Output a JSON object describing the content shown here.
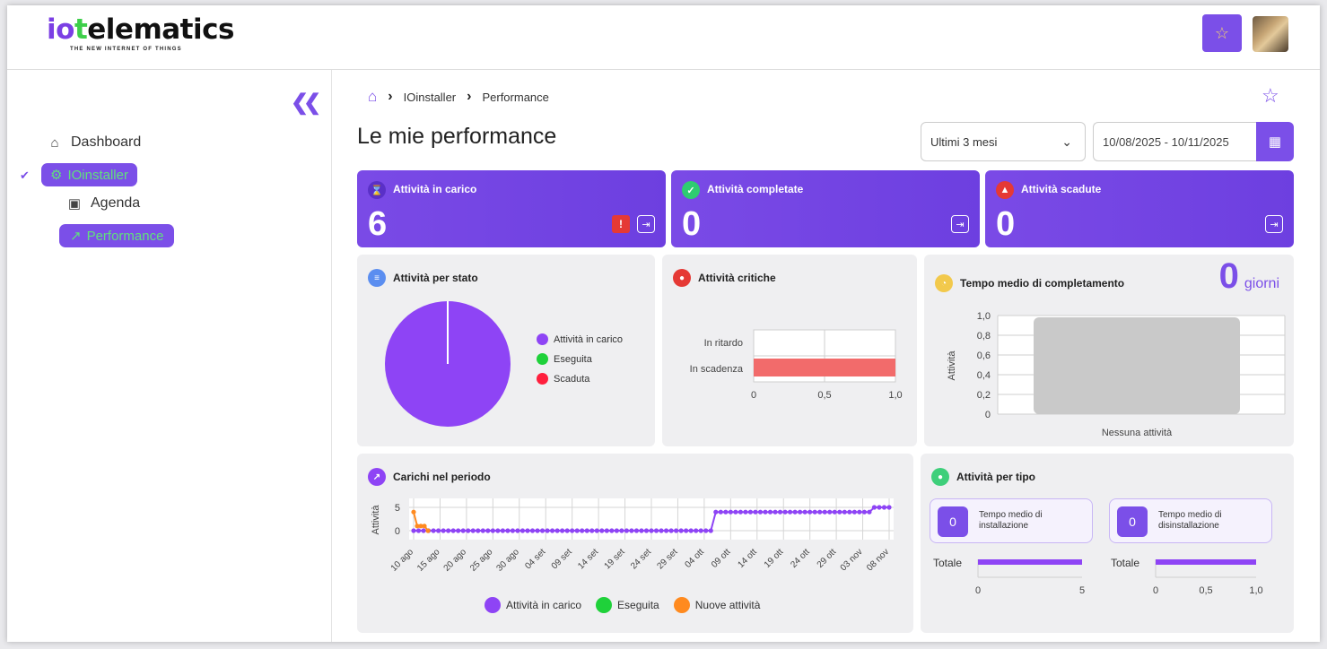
{
  "brand": {
    "name_io": "io",
    "name_t": "t",
    "name_rest": "elematics",
    "tagline": "THE NEW INTERNET OF THINGS"
  },
  "header": {
    "star_icon": "star-icon",
    "avatar": "user-avatar"
  },
  "sidebar": {
    "collapse_icon": "double-chevron-left-icon",
    "items": [
      {
        "label": "Dashboard",
        "icon": "home-icon"
      },
      {
        "label": "IOinstaller",
        "icon": "installer-icon"
      },
      {
        "label": "Agenda",
        "icon": "calendar-icon"
      },
      {
        "label": "Performance",
        "icon": "chart-line-icon"
      }
    ]
  },
  "breadcrumb": {
    "items": [
      "IOinstaller",
      "Performance"
    ]
  },
  "page": {
    "title": "Le mie performance"
  },
  "filters": {
    "period": "Ultimi 3 mesi",
    "range": "10/08/2025 - 10/11/2025"
  },
  "kpis": [
    {
      "label": "Attività in carico",
      "value": "6",
      "alert": "!",
      "icon_color": "#5a30c7"
    },
    {
      "label": "Attività completate",
      "value": "0",
      "icon_color": "#2ecc71"
    },
    {
      "label": "Attività scadute",
      "value": "0",
      "icon_color": "#e53935"
    }
  ],
  "panels": {
    "stato": {
      "title": "Attività per stato",
      "legend": [
        {
          "label": "Attività in carico",
          "color": "#8e44f5"
        },
        {
          "label": "Eseguita",
          "color": "#1fd13a"
        },
        {
          "label": "Scaduta",
          "color": "#ff1f3d"
        }
      ]
    },
    "critiche": {
      "title": "Attività critiche"
    },
    "tempo": {
      "title": "Tempo medio di completamento",
      "value": "0",
      "unit": "giorni",
      "empty_label": "Nessuna attività"
    },
    "carichi": {
      "title": "Carichi nel periodo",
      "legend": [
        {
          "label": "Attività in carico",
          "color": "#8e44f5"
        },
        {
          "label": "Eseguita",
          "color": "#1fd13a"
        },
        {
          "label": "Nuove attività",
          "color": "#ff8a1f"
        }
      ]
    },
    "tipo": {
      "title": "Attività per tipo",
      "cards": [
        {
          "value": "0",
          "label": "Tempo medio di installazione"
        },
        {
          "value": "0",
          "label": "Tempo medio di disinstallazione"
        }
      ],
      "totale_label": "Totale"
    }
  },
  "chart_data": [
    {
      "type": "pie",
      "title": "Attività per stato",
      "categories": [
        "Attività in carico",
        "Eseguita",
        "Scaduta"
      ],
      "values": [
        6,
        0,
        0
      ]
    },
    {
      "type": "bar",
      "title": "Attività critiche",
      "orientation": "horizontal",
      "categories": [
        "In ritardo",
        "In scadenza"
      ],
      "values": [
        0,
        1
      ],
      "xlim": [
        0,
        1
      ],
      "xticks": [
        "0",
        "0,5",
        "1,0"
      ]
    },
    {
      "type": "bar",
      "title": "Tempo medio di completamento",
      "ylabel": "Attività",
      "categories": [
        "Nessuna attività"
      ],
      "values": [
        1
      ],
      "ylim": [
        0,
        1
      ],
      "yticks": [
        "0",
        "0,2",
        "0,4",
        "0,6",
        "0,8",
        "1,0"
      ]
    },
    {
      "type": "line",
      "title": "Carichi nel periodo",
      "ylabel": "Attività",
      "xticks": [
        "10 ago",
        "15 ago",
        "20 ago",
        "25 ago",
        "30 ago",
        "04 set",
        "09 set",
        "14 set",
        "19 set",
        "24 set",
        "29 set",
        "04 ott",
        "09 ott",
        "14 ott",
        "19 ott",
        "24 ott",
        "29 ott",
        "03 nov",
        "08 nov"
      ],
      "yticks": [
        "0",
        "5"
      ],
      "series": [
        {
          "name": "Attività in carico",
          "values": [
            0,
            0,
            0,
            0,
            0,
            0,
            0,
            0,
            0,
            0,
            0,
            0,
            0,
            0,
            0,
            0,
            0,
            0,
            0,
            0,
            0,
            0,
            0,
            0,
            0,
            0,
            0,
            0,
            0,
            0,
            0,
            0,
            0,
            0,
            0,
            0,
            0,
            0,
            0,
            0,
            0,
            0,
            0,
            0,
            0,
            0,
            0,
            0,
            0,
            0,
            0,
            0,
            0,
            0,
            0,
            0,
            0,
            0,
            0,
            0,
            0,
            4,
            4,
            4,
            4,
            4,
            4,
            4,
            4,
            4,
            4,
            4,
            4,
            4,
            4,
            4,
            4,
            4,
            4,
            4,
            4,
            4,
            4,
            4,
            4,
            4,
            4,
            4,
            4,
            4,
            4,
            4,
            4,
            5,
            5,
            5,
            5
          ]
        },
        {
          "name": "Eseguita",
          "values": []
        },
        {
          "name": "Nuove attività",
          "values": [
            4,
            1,
            1,
            1,
            0
          ]
        }
      ]
    },
    {
      "type": "bar",
      "title": "Attività per tipo — Totale (installazione)",
      "orientation": "horizontal",
      "categories": [
        "Totale"
      ],
      "values": [
        5
      ],
      "xticks": [
        "0",
        "5"
      ]
    },
    {
      "type": "bar",
      "title": "Attività per tipo — Totale (disinstallazione)",
      "orientation": "horizontal",
      "categories": [
        "Totale"
      ],
      "values": [
        1
      ],
      "xticks": [
        "0",
        "0,5",
        "1,0"
      ]
    }
  ]
}
